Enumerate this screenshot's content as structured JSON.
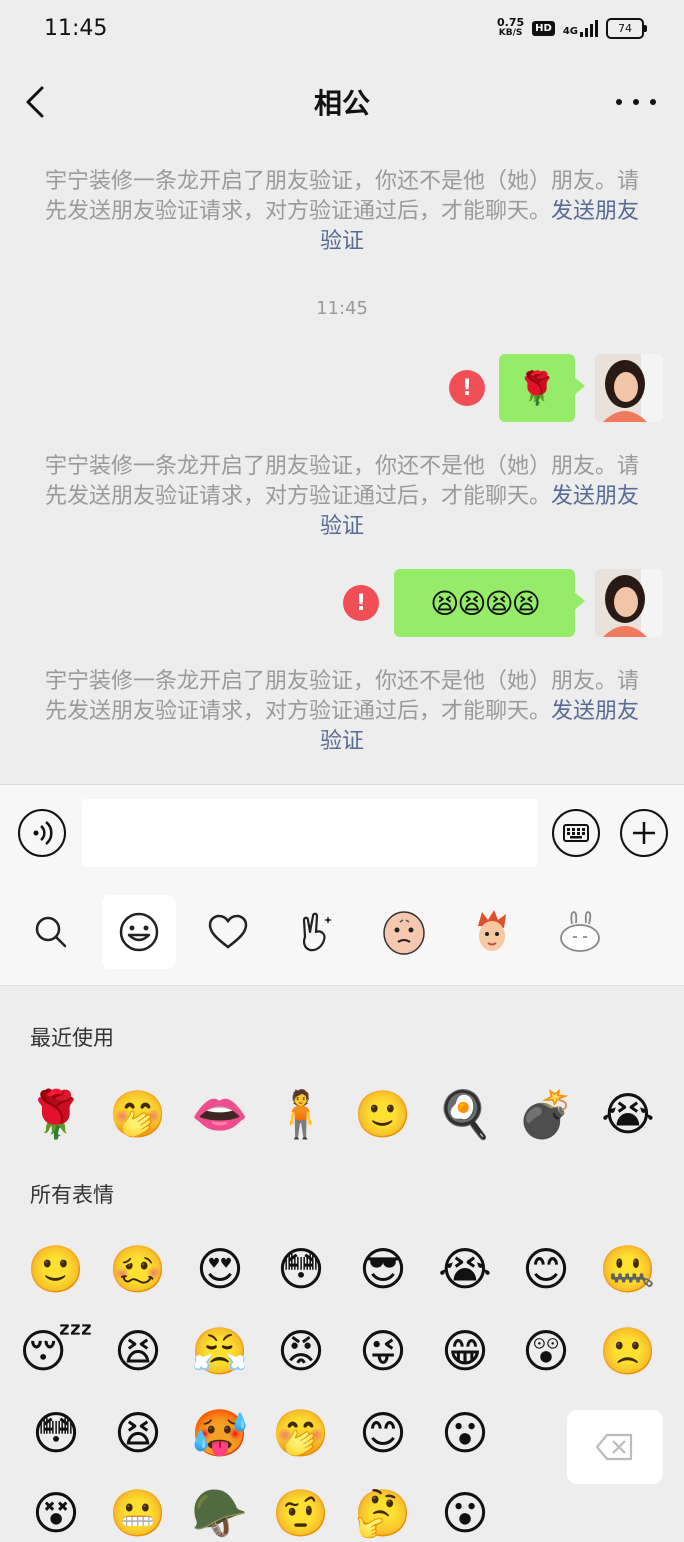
{
  "status_bar": {
    "time": "11:45",
    "net_speed_value": "0.75",
    "net_speed_unit": "KB/S",
    "hd_badge": "HD",
    "signal_label": "4G",
    "battery": "74"
  },
  "header": {
    "title": "相公"
  },
  "messages": {
    "system_text": "宇宁装修一条龙开启了朋友验证，你还不是他（她）朋友。请先发送朋友验证请求，对方验证通过后，才能聊天。",
    "system_link": "发送朋友验证",
    "timestamp": "11:45",
    "error_mark": "!",
    "bubble1_emoji": "🌹",
    "bubble2_emoji": "😫😫😫😫"
  },
  "emoji_panel": {
    "recent_label": "最近使用",
    "all_label": "所有表情",
    "recent": [
      "🌹",
      "🤭",
      "👄",
      "🧍",
      "🙂",
      "🍳",
      "💣",
      "😭"
    ],
    "all_row1": [
      "🙂",
      "🥴",
      "😍",
      "😳",
      "😎",
      "😭",
      "😊",
      "🤐"
    ],
    "all_row2": [
      "😴",
      "😫",
      "😤",
      "😡",
      "😜",
      "😁",
      "😲",
      "🙁"
    ],
    "all_row3": [
      "😳",
      "😫",
      "🥵",
      "🤭",
      "😊",
      "😮"
    ],
    "all_row4": [
      "😵",
      "😬",
      "🪖",
      "🤨",
      "🤔",
      "😮"
    ]
  },
  "colors": {
    "bubble": "#95ec69",
    "link": "#576b95",
    "error": "#f05055"
  }
}
